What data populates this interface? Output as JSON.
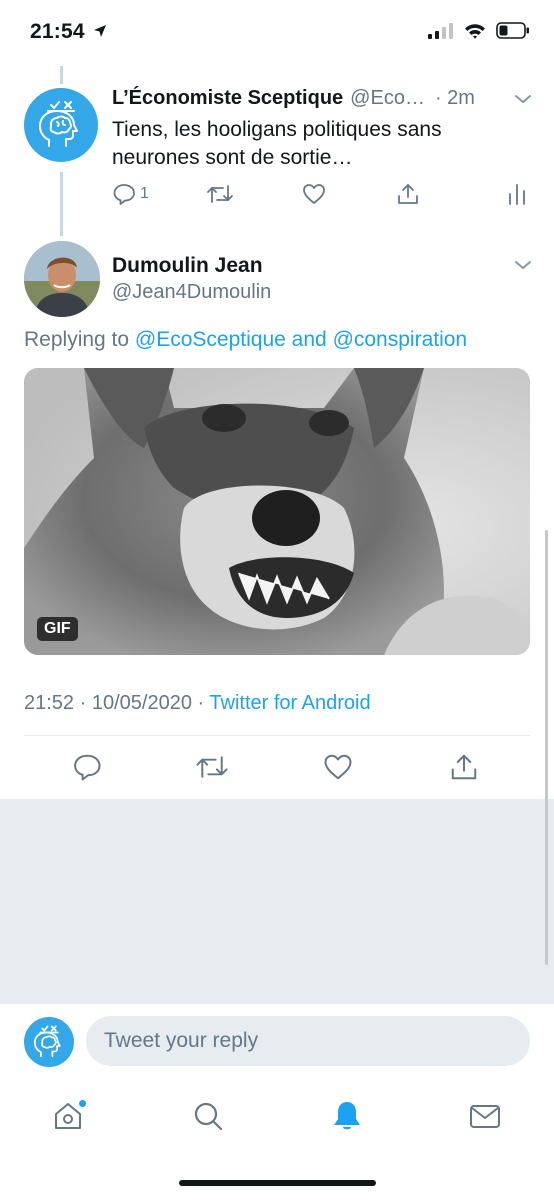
{
  "status_bar": {
    "time": "21:54"
  },
  "tweet_parent": {
    "name": "L’Économiste Sceptique",
    "handle": "@Eco…",
    "time": "· 2m",
    "text": "Tiens, les hooligans politiques sans neurones sont de sortie…",
    "reply_count": "1"
  },
  "tweet_main": {
    "name": "Dumoulin Jean",
    "handle": "@Jean4Dumoulin",
    "replying_prefix": "Replying to",
    "replying_to_1": "@EcoSceptique",
    "replying_and": "and",
    "replying_to_2": "@conspiration",
    "gif_badge": "GIF",
    "time": "21:52",
    "date": "10/05/2020",
    "source": "Twitter for Android"
  },
  "reply_bar": {
    "placeholder": "Tweet your reply"
  },
  "colors": {
    "accent": "#1da1f2",
    "secondary_text": "#657786",
    "divider": "#e6ecf0"
  },
  "icons": {
    "status": [
      "location-arrow-icon",
      "signal-icon",
      "wifi-icon",
      "battery-icon"
    ],
    "tweet_actions": [
      "reply-icon",
      "retweet-icon",
      "like-icon",
      "share-icon",
      "analytics-icon"
    ],
    "tabs": [
      "home-icon",
      "search-icon",
      "notifications-bell-icon",
      "messages-icon"
    ]
  }
}
